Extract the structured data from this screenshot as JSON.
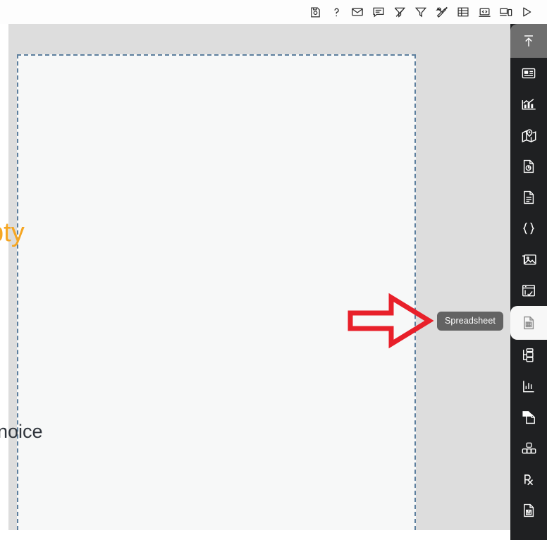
{
  "toolbar": {
    "buttons": [
      {
        "name": "save-icon",
        "label": "Save"
      },
      {
        "name": "help-icon",
        "label": "Help"
      },
      {
        "name": "mail-icon",
        "label": "Mail"
      },
      {
        "name": "comment-icon",
        "label": "Comment"
      },
      {
        "name": "filter-off-icon",
        "label": "Clear Filter"
      },
      {
        "name": "filter-icon",
        "label": "Filter"
      },
      {
        "name": "tools-icon",
        "label": "Tools"
      },
      {
        "name": "table-icon",
        "label": "Table"
      },
      {
        "name": "code-laptop-icon",
        "label": "Code"
      },
      {
        "name": "devices-icon",
        "label": "Devices"
      },
      {
        "name": "play-icon",
        "label": "Run"
      }
    ]
  },
  "page": {
    "text_orange": "pty",
    "text_dark": "noice"
  },
  "sidebar": {
    "items": [
      {
        "name": "sidebar-item-upload",
        "label": "Upload",
        "state": "highlighted"
      },
      {
        "name": "sidebar-item-card",
        "label": "Card",
        "state": "normal"
      },
      {
        "name": "sidebar-item-chart",
        "label": "Chart",
        "state": "normal"
      },
      {
        "name": "sidebar-item-map",
        "label": "Map",
        "state": "normal"
      },
      {
        "name": "sidebar-item-report",
        "label": "Report",
        "state": "normal"
      },
      {
        "name": "sidebar-item-document",
        "label": "Document",
        "state": "normal"
      },
      {
        "name": "sidebar-item-code",
        "label": "Code",
        "state": "normal"
      },
      {
        "name": "sidebar-item-image",
        "label": "Image",
        "state": "normal"
      },
      {
        "name": "sidebar-item-form",
        "label": "Form",
        "state": "normal"
      },
      {
        "name": "sidebar-item-spreadsheet",
        "label": "Spreadsheet",
        "state": "active"
      },
      {
        "name": "sidebar-item-tree",
        "label": "Tree",
        "state": "normal"
      },
      {
        "name": "sidebar-item-graph",
        "label": "Graph",
        "state": "normal"
      },
      {
        "name": "sidebar-item-duplicate",
        "label": "Duplicate",
        "state": "normal"
      },
      {
        "name": "sidebar-item-blocks",
        "label": "Blocks",
        "state": "normal"
      },
      {
        "name": "sidebar-item-prescription",
        "label": "Rx",
        "state": "normal"
      },
      {
        "name": "sidebar-item-save-document",
        "label": "Save Document",
        "state": "normal"
      }
    ]
  },
  "tooltip": {
    "text": "Spreadsheet"
  },
  "annotation": {
    "arrow_name": "red-pointer-arrow",
    "arrow_color": "#e8202a",
    "direction": "right"
  },
  "colors": {
    "toolbar_bg": "#fdfdfd",
    "canvas_bg": "#dddddd",
    "page_bg": "#f7f8f8",
    "page_border": "#5d7f9e",
    "sidebar_bg": "#1f2022",
    "sidebar_highlight": "#6e6e6e",
    "sidebar_active": "#f7f7f7",
    "tooltip_bg": "#636363",
    "text_orange": "#f5a623",
    "text_dark": "#30353c"
  }
}
